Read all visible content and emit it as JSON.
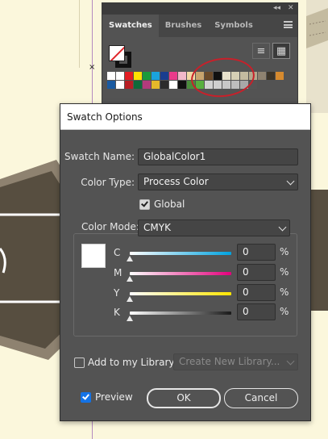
{
  "swatches_panel": {
    "tabs": [
      {
        "label": "Swatches",
        "active": true
      },
      {
        "label": "Brushes",
        "active": false
      },
      {
        "label": "Symbols",
        "active": false
      }
    ],
    "collapse_glyph": "◂◂",
    "close_glyph": "✕",
    "list_view_glyph": "≡",
    "grid_view_glyph": "▦",
    "swatch_rows": [
      [
        "#ffffff",
        "#ffffff",
        "#e21d24",
        "#ffe000",
        "#1b9a3b",
        "#1aa3dc",
        "#1a3d8f",
        "#ea3a8a",
        "#f2b8c9",
        "#f3d9a4",
        "#c8a46e",
        "#6b4a2a",
        "#111111",
        "#e8e2cc",
        "#d6cfb5",
        "#c4bba0",
        "#b3a88c",
        "#8e8270",
        "#3d3529",
        "#d68a2e"
      ],
      [
        "#1a5aa0",
        "#ffffff",
        "#b81e24",
        "#0e6a3a",
        "#b23b7c",
        "#e6b82a",
        "#2c2c2c",
        "#ffffff",
        "#111111",
        "#4a8d3c",
        "#58b03f",
        "#d2d2d2",
        "#cfcfcf",
        "#c8c8c8",
        "#bdbdbd",
        "#a8a8a8",
        "#555555",
        "#535353",
        "#535353",
        "#535353"
      ]
    ],
    "highlight_color": "#c8202a"
  },
  "dialog": {
    "title": "Swatch Options",
    "swatch_name_label": "Swatch Name:",
    "swatch_name_value": "GlobalColor1",
    "color_type_label": "Color Type:",
    "color_type_value": "Process Color",
    "global_label": "Global",
    "global_checked": true,
    "color_mode_label": "Color Mode:",
    "color_mode_value": "CMYK",
    "preview_color": "#ffffff",
    "channels": [
      {
        "name": "C",
        "value": "0",
        "unit": "%",
        "gradient": "linear-gradient(to right,#ffffff,#00a3e0)"
      },
      {
        "name": "M",
        "value": "0",
        "unit": "%",
        "gradient": "linear-gradient(to right,#ffffff,#e4007c)"
      },
      {
        "name": "Y",
        "value": "0",
        "unit": "%",
        "gradient": "linear-gradient(to right,#ffffff,#ffe500)"
      },
      {
        "name": "K",
        "value": "0",
        "unit": "%",
        "gradient": "linear-gradient(to right,#ffffff,#1a1a1a)"
      }
    ],
    "add_library_label": "Add to my Library",
    "add_library_checked": false,
    "library_select_value": "Create New Library...",
    "preview_label": "Preview",
    "preview_checked": true,
    "ok_label": "OK",
    "cancel_label": "Cancel"
  }
}
